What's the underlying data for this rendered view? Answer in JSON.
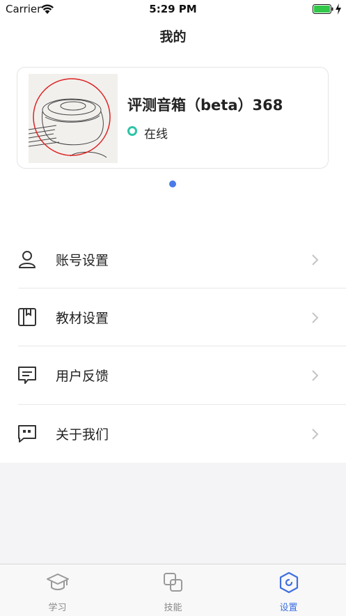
{
  "status_bar": {
    "carrier": "Carrier",
    "time": "5:29 PM"
  },
  "header": {
    "title": "我的"
  },
  "device": {
    "name": "评测音箱（beta）368",
    "status": "在线",
    "status_color": "#2ec4a6"
  },
  "pager": {
    "active_color": "#4a7be8"
  },
  "menu": [
    {
      "label": "账号设置",
      "icon": "user-icon"
    },
    {
      "label": "教材设置",
      "icon": "book-icon"
    },
    {
      "label": "用户反馈",
      "icon": "feedback-icon"
    },
    {
      "label": "关于我们",
      "icon": "quote-icon"
    }
  ],
  "tabs": [
    {
      "label": "学习",
      "icon": "graduation-cap-icon",
      "active": false
    },
    {
      "label": "技能",
      "icon": "skills-icon",
      "active": false
    },
    {
      "label": "设置",
      "icon": "settings-icon",
      "active": true
    }
  ],
  "colors": {
    "accent": "#3f6fe0",
    "inactive_tab": "#888888",
    "icon": "#333333"
  }
}
